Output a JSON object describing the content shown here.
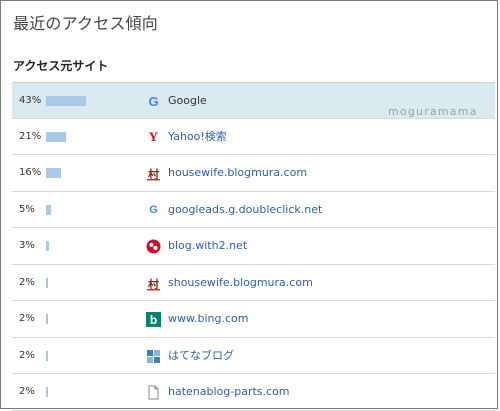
{
  "page_title": "最近のアクセス傾向",
  "section_title": "アクセス元サイト",
  "watermark": "moguramama",
  "bar_color": "#a7c8e6",
  "rows": [
    {
      "percent": "43%",
      "value": 43,
      "site": "Google",
      "icon": "google-icon"
    },
    {
      "percent": "21%",
      "value": 21,
      "site": "Yahoo!検索",
      "icon": "yahoo-icon"
    },
    {
      "percent": "16%",
      "value": 16,
      "site": "housewife.blogmura.com",
      "icon": "blogmura-icon"
    },
    {
      "percent": "5%",
      "value": 5,
      "site": "googleads.g.doubleclick.net",
      "icon": "google-icon"
    },
    {
      "percent": "3%",
      "value": 3,
      "site": "blog.with2.net",
      "icon": "with2-icon"
    },
    {
      "percent": "2%",
      "value": 2,
      "site": "shousewife.blogmura.com",
      "icon": "blogmura-icon"
    },
    {
      "percent": "2%",
      "value": 2,
      "site": "www.bing.com",
      "icon": "bing-icon"
    },
    {
      "percent": "2%",
      "value": 2,
      "site": "はてなブログ",
      "icon": "hatena-icon"
    },
    {
      "percent": "2%",
      "value": 2,
      "site": "hatenablog-parts.com",
      "icon": "document-icon"
    }
  ]
}
